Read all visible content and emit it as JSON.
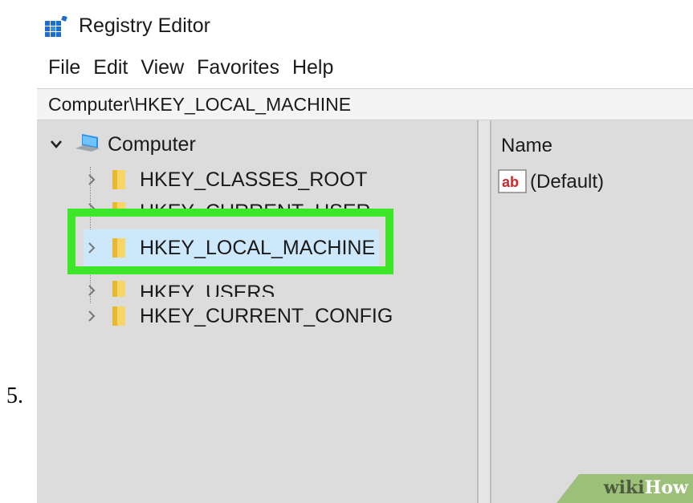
{
  "step_number": "5.",
  "window": {
    "title": "Registry Editor",
    "icon": "registry-editor-icon"
  },
  "menu": {
    "items": [
      "File",
      "Edit",
      "View",
      "Favorites",
      "Help"
    ]
  },
  "address": {
    "path": "Computer\\HKEY_LOCAL_MACHINE"
  },
  "tree": {
    "root": {
      "label": "Computer",
      "icon": "computer-icon",
      "expanded": true
    },
    "items": [
      {
        "label": "HKEY_CLASSES_ROOT",
        "icon": "folder-icon"
      },
      {
        "label": "HKEY_CURRENT_USER",
        "icon": "folder-icon"
      },
      {
        "label": "HKEY_LOCAL_MACHINE",
        "icon": "folder-icon",
        "selected": true
      },
      {
        "label": "HKEY_USERS",
        "icon": "folder-icon"
      },
      {
        "label": "HKEY_CURRENT_CONFIG",
        "icon": "folder-icon"
      }
    ]
  },
  "values": {
    "column_name": "Name",
    "rows": [
      {
        "name": "(Default)",
        "icon": "string-value-icon"
      }
    ]
  },
  "watermark": {
    "part1": "wiki",
    "part2": "How"
  },
  "colors": {
    "highlight": "#3ee62a",
    "selection": "#cde8fb",
    "pane_bg": "#dcdcdc"
  }
}
